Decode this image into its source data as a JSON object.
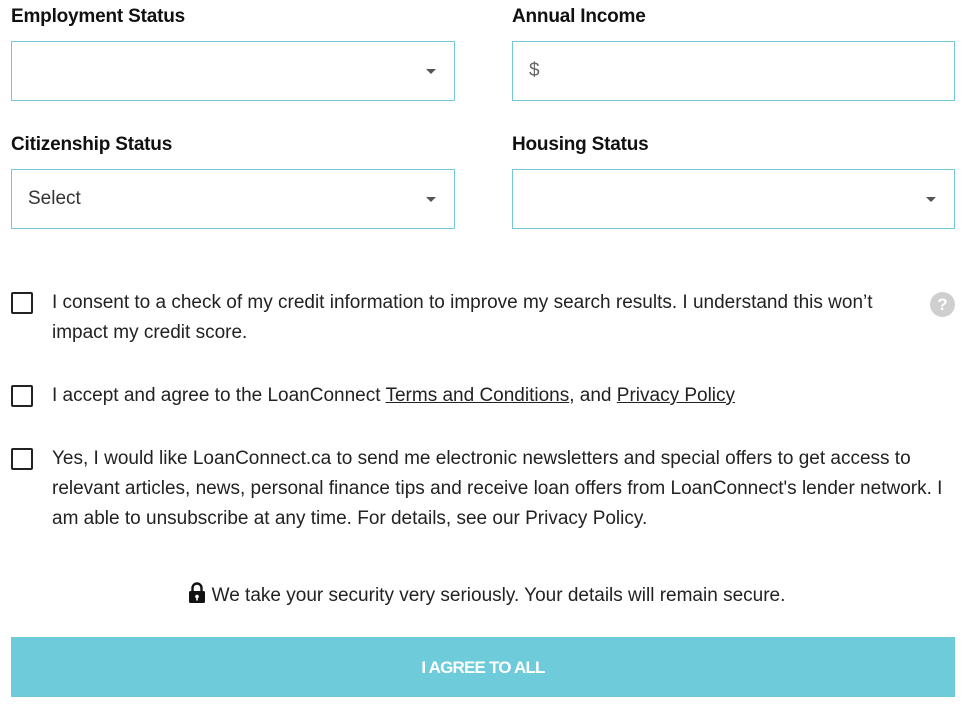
{
  "form": {
    "employment": {
      "label": "Employment Status",
      "value": ""
    },
    "income": {
      "label": "Annual Income",
      "prefix": "$",
      "value": ""
    },
    "citizenship": {
      "label": "Citizenship Status",
      "value": "Select"
    },
    "housing": {
      "label": "Housing Status",
      "value": ""
    }
  },
  "consents": {
    "credit_check": {
      "text": "I consent to a check of my credit information to improve my search results. I understand this won’t impact my credit score.",
      "help_icon": "question-mark",
      "help_glyph": "?"
    },
    "terms": {
      "prefix": "I accept and agree to the LoanConnect ",
      "terms_link": "Terms and Conditions",
      "middle": ", and ",
      "privacy_link": "Privacy Policy"
    },
    "newsletter": {
      "text": "Yes, I would like LoanConnect.ca to send me electronic newsletters and special offers to get access to relevant articles, news, personal finance tips and receive loan offers from LoanConnect's lender network. I am able to unsubscribe at any time. For details, see our Privacy Policy."
    }
  },
  "security": {
    "icon": "lock-icon",
    "text": "We take your security very seriously. Your details will remain secure."
  },
  "submit": {
    "label": "I AGREE TO ALL"
  },
  "colors": {
    "accent": "#6ecbd9",
    "field_border": "#74c9d4"
  }
}
